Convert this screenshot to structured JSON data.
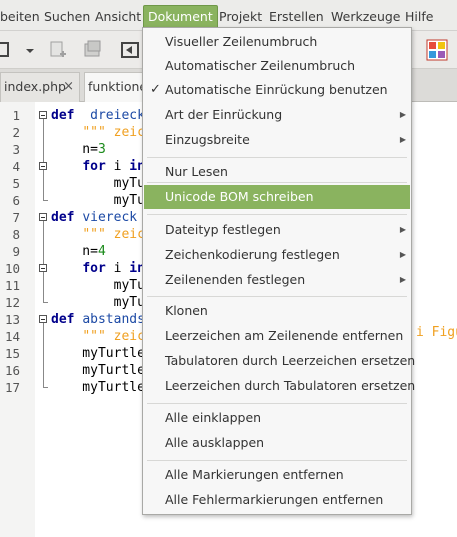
{
  "menubar": {
    "items": [
      "beiten",
      "Suchen",
      "Ansicht",
      "Dokument",
      "Projekt",
      "Erstellen",
      "Werkzeuge",
      "Hilfe"
    ]
  },
  "tabs": [
    {
      "label": "index.php",
      "close": "×"
    },
    {
      "label": "funktione"
    }
  ],
  "dropdown": {
    "items": [
      {
        "label": "Visueller Zeilenumbruch"
      },
      {
        "label": "Automatischer Zeilenumbruch"
      },
      {
        "label": "Automatische Einrückung benutzen",
        "checked": true
      },
      {
        "label": "Art der Einrückung",
        "submenu": true
      },
      {
        "label": "Einzugsbreite",
        "submenu": true
      },
      {
        "label": "Nur Lesen"
      },
      {
        "label": "Unicode BOM schreiben",
        "highlighted": true
      },
      {
        "label": "Dateityp festlegen",
        "submenu": true
      },
      {
        "label": "Zeichenkodierung festlegen",
        "submenu": true
      },
      {
        "label": "Zeilenenden festlegen",
        "submenu": true
      },
      {
        "label": "Klonen"
      },
      {
        "label": "Leerzeichen am Zeilenende entfernen"
      },
      {
        "label": "Tabulatoren durch Leerzeichen ersetzen"
      },
      {
        "label": "Leerzeichen durch Tabulatoren ersetzen"
      },
      {
        "label": "Alle einklappen"
      },
      {
        "label": "Alle ausklappen"
      },
      {
        "label": "Alle Markierungen entfernen"
      },
      {
        "label": "Alle Fehlermarkierungen entfernen"
      }
    ]
  },
  "editor": {
    "lines": [
      {
        "n": "1",
        "t": [
          [
            "kw",
            "def"
          ],
          [
            "",
            "  "
          ],
          [
            "fn",
            "dreieck"
          ]
        ]
      },
      {
        "n": "2",
        "t": [
          [
            "",
            "    "
          ],
          [
            "str",
            "\"\"\" zeic"
          ]
        ]
      },
      {
        "n": "3",
        "t": [
          [
            "",
            "    n="
          ],
          [
            "num",
            "3"
          ]
        ]
      },
      {
        "n": "4",
        "t": [
          [
            "",
            "    "
          ],
          [
            "kw",
            "for"
          ],
          [
            "",
            " i "
          ],
          [
            "kw",
            "in"
          ]
        ]
      },
      {
        "n": "5",
        "t": [
          [
            "",
            "        myTur"
          ]
        ]
      },
      {
        "n": "6",
        "t": [
          [
            "",
            "        myTur"
          ]
        ]
      },
      {
        "n": "7",
        "t": [
          [
            "kw",
            "def"
          ],
          [
            "",
            " "
          ],
          [
            "fn",
            "viereck"
          ]
        ]
      },
      {
        "n": "8",
        "t": [
          [
            "",
            "    "
          ],
          [
            "str",
            "\"\"\" zeic"
          ]
        ]
      },
      {
        "n": "9",
        "t": [
          [
            "",
            "    n="
          ],
          [
            "num",
            "4"
          ]
        ]
      },
      {
        "n": "10",
        "t": [
          [
            "",
            "    "
          ],
          [
            "kw",
            "for"
          ],
          [
            "",
            " i "
          ],
          [
            "kw",
            "in"
          ]
        ]
      },
      {
        "n": "11",
        "t": [
          [
            "",
            "        myTur"
          ]
        ]
      },
      {
        "n": "12",
        "t": [
          [
            "",
            "        myTur"
          ]
        ]
      },
      {
        "n": "13",
        "t": [
          [
            "kw",
            "def"
          ],
          [
            "",
            " "
          ],
          [
            "fn",
            "abstands"
          ]
        ]
      },
      {
        "n": "14",
        "t": [
          [
            "",
            "    "
          ],
          [
            "str",
            "\"\"\" zeic"
          ]
        ]
      },
      {
        "n": "15",
        "t": [
          [
            "",
            "    myTurtle"
          ]
        ]
      },
      {
        "n": "16",
        "t": [
          [
            "",
            "    myTurtle"
          ]
        ]
      },
      {
        "n": "17",
        "t": [
          [
            "",
            "    myTurtle"
          ]
        ]
      }
    ],
    "overflow_text": "i Figu"
  },
  "colors": {
    "accent": "#8ab35f",
    "keyword": "#00008b",
    "string": "#f0a020",
    "number": "#1a8a1a"
  }
}
